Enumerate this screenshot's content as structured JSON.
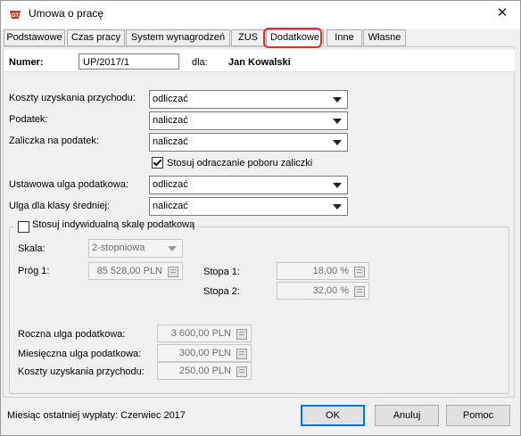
{
  "window": {
    "title": "Umowa o pracę",
    "close": "✕"
  },
  "tabs": [
    {
      "label": "Podstawowe"
    },
    {
      "label": "Czas pracy"
    },
    {
      "label": "System wynagrodzeń"
    },
    {
      "label": "ZUS"
    },
    {
      "label": "Dodatkowe",
      "active": true
    },
    {
      "label": "Inne"
    },
    {
      "label": "Własne"
    }
  ],
  "header": {
    "numer_label": "Numer:",
    "numer_value": "UP/2017/1",
    "dla_label": "dla:",
    "employee": "Jan Kowalski"
  },
  "fields": {
    "koszty_label": "Koszty uzyskania przychodu:",
    "koszty_value": "odliczać",
    "podatek_label": "Podatek:",
    "podatek_value": "naliczać",
    "zaliczka_label": "Zaliczka na podatek:",
    "zaliczka_value": "naliczać",
    "odraczanie_label": "Stosuj odraczanie poboru zaliczki",
    "odraczanie_checked": true,
    "ulga_label": "Ustawowa ulga podatkowa:",
    "ulga_value": "odliczać",
    "klasa_label": "Ulga dla klasy średniej:",
    "klasa_value": "naliczać"
  },
  "scale_group": {
    "legend": "Stosuj indywidualną skalę podatkową",
    "checked": false,
    "skala_label": "Skala:",
    "skala_value": "2-stopniowa",
    "prog_label": "Próg 1:",
    "prog_value": "85 528,00 PLN",
    "stopa1_label": "Stopa 1:",
    "stopa1_value": "18,00 %",
    "stopa2_label": "Stopa 2:",
    "stopa2_value": "32,00 %",
    "roczna_label": "Roczna ulga podatkowa:",
    "roczna_value": "3 600,00 PLN",
    "miesieczna_label": "Miesięczna ulga podatkowa:",
    "miesieczna_value": "300,00 PLN",
    "koszty_label": "Koszty uzyskania przychodu:",
    "koszty_value": "250,00 PLN"
  },
  "footer": {
    "status": "Miesiąc ostatniej wypłaty: Czerwiec 2017",
    "ok": "OK",
    "cancel": "Anuluj",
    "help": "Pomoc"
  },
  "colors": {
    "tab_highlight": "#e8262c",
    "default_button": "#0078d7"
  }
}
